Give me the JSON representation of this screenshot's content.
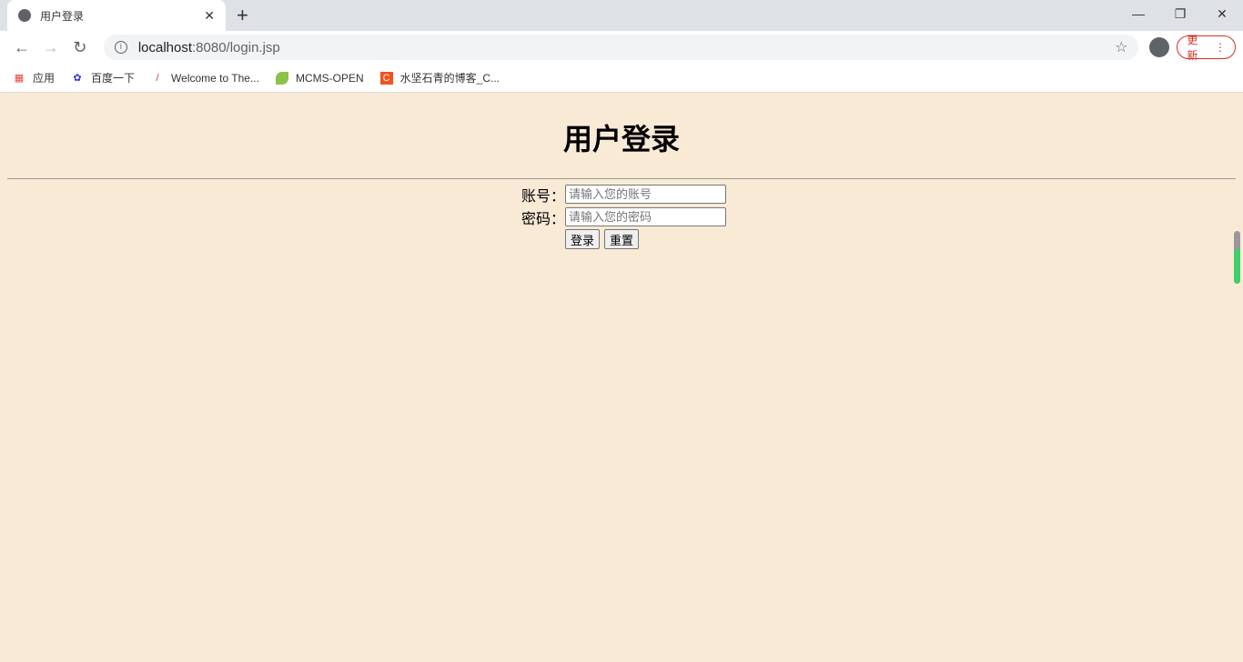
{
  "browser": {
    "tab_title": "用户登录",
    "url_host": "localhost",
    "url_path": ":8080/login.jsp",
    "update_label": "更新",
    "bookmarks": [
      {
        "label": "应用",
        "icon": "apps-grid-icon"
      },
      {
        "label": "百度一下",
        "icon": "baidu-paw-icon"
      },
      {
        "label": "Welcome to The...",
        "icon": "feather-icon"
      },
      {
        "label": "MCMS-OPEN",
        "icon": "leaf-icon"
      },
      {
        "label": "水坚石青的博客_C...",
        "icon": "csdn-c-icon"
      }
    ]
  },
  "page": {
    "title": "用户登录",
    "username_label": "账号：",
    "username_placeholder": "请输入您的账号",
    "username_value": "",
    "password_label": "密码：",
    "password_placeholder": "请输入您的密码",
    "password_value": "",
    "login_label": "登录",
    "reset_label": "重置"
  },
  "colors": {
    "page_bg": "#f9ead6",
    "update_accent": "#d93025"
  }
}
